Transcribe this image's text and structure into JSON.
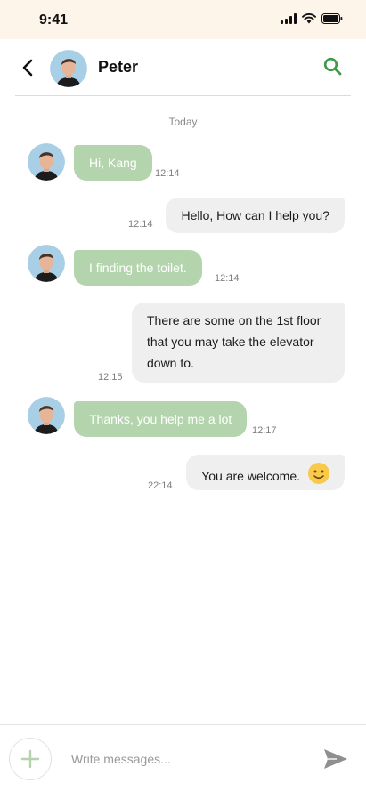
{
  "status_bar": {
    "time": "9:41"
  },
  "header": {
    "contact_name": "Peter",
    "back_icon": "chevron-left-icon",
    "search_icon": "search-icon"
  },
  "chat": {
    "day_label": "Today",
    "messages": [
      {
        "from": "peter",
        "text": "Hi, Kang",
        "time": "12:14"
      },
      {
        "from": "me",
        "text": "Hello, How can I help you?",
        "time": "12:14"
      },
      {
        "from": "peter",
        "text": "I finding the toilet.",
        "time": "12:14"
      },
      {
        "from": "me",
        "text": "There are some on the 1st floor that you may take the elevator down to.",
        "time": "12:15"
      },
      {
        "from": "peter",
        "text": "Thanks, you help me a lot",
        "time": "12:17"
      },
      {
        "from": "me",
        "text": "You are welcome.",
        "time": "22:14",
        "emoji": "smiley-face-icon"
      }
    ]
  },
  "composer": {
    "placeholder": "Write messages...",
    "add_icon": "plus-icon",
    "send_icon": "send-icon"
  },
  "colors": {
    "accent": "#3c9a48",
    "incoming_bubble": "#b4d4ad",
    "outgoing_bubble": "#efefef",
    "status_bar_bg": "#fdf4ea"
  }
}
